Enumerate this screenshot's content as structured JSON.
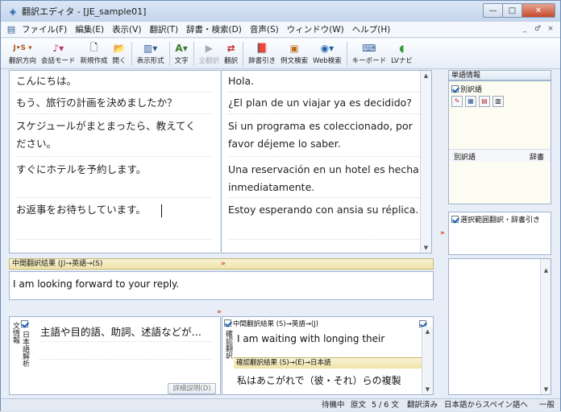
{
  "window": {
    "title": "翻訳エディタ - [JE_sample01]",
    "controls": {
      "minimize": "—",
      "maximize": "□",
      "close": "✕"
    }
  },
  "menu": {
    "items": [
      "ファイル(F)",
      "編集(E)",
      "表示(V)",
      "翻訳(T)",
      "辞書・検索(D)",
      "音声(S)",
      "ウィンドウ(W)",
      "ヘルプ(H)"
    ],
    "mdi": [
      "_",
      "♂",
      "×"
    ]
  },
  "toolbar": {
    "buttons": [
      {
        "icon": "J•S ▾",
        "label": "翻訳方向"
      },
      {
        "icon": "♪▾",
        "label": "会話モード"
      },
      {
        "icon": "🗋",
        "label": "新規作成"
      },
      {
        "icon": "📂",
        "label": "開く"
      },
      {
        "icon": "▥▾",
        "label": "表示形式"
      },
      {
        "icon": "A▾",
        "label": "文字"
      },
      {
        "icon": "▶",
        "label": "全翻訳"
      },
      {
        "icon": "⇄",
        "label": "翻訳"
      },
      {
        "icon": "📕",
        "label": "辞書引き"
      },
      {
        "icon": "▣",
        "label": "例文検索"
      },
      {
        "icon": "◉▾",
        "label": "Web検索"
      },
      {
        "icon": "⌨",
        "label": "キーボード"
      },
      {
        "icon": "◖",
        "label": "LVナビ"
      }
    ]
  },
  "source_rows": [
    "こんにちは。",
    "もう、旅行の計画を決めましたか？",
    "スケジュールがまとまったら、教えてく",
    "ださい。",
    "すぐにホテルを予約します。",
    "お返事をお待ちしています。"
  ],
  "target_rows": [
    "Hola.",
    "¿El plan de un viajar ya es decidido?",
    "Si un programa es coleccionado, por",
    "favor déjeme lo saber.",
    "Una reservación en un hotel es hecha",
    "inmediatamente.",
    "Estoy esperando con ansia su réplica."
  ],
  "intermediate": {
    "header": "中間翻訳結果 (J)→英語→(S)",
    "text": "I am looking forward to your reply."
  },
  "word_info": {
    "header": "単語情報",
    "alt_checkbox": "別訳語",
    "col_alt": "別訳語",
    "col_dict": "辞書",
    "selection_checkbox": "選択範囲翻訳・辞書引き"
  },
  "bottom_left": {
    "side_label": "文情報",
    "checkbox_label": "日本語解析",
    "text": "主語や目的語、助詞、述語などが…",
    "button": "詳細説明(D)"
  },
  "bottom_right": {
    "side_label": "確認翻訳",
    "header1": "中間翻訳結果 (S)→英語→(J)",
    "text1": "I am waiting with longing their",
    "header2": "確認翻訳結果 (S)→(E)→日本語",
    "text2": "私はあこがれで（彼・それ）らの複製"
  },
  "status": {
    "state": "待機中",
    "mode": "原文",
    "position": "5 / 6 文",
    "translated": "翻訳済み",
    "direction": "日本語からスペイン語へ",
    "field": "一般"
  },
  "colors": {
    "accent": "#1f5faa",
    "panel_head": "#efe3a8",
    "close": "#c4492c"
  }
}
